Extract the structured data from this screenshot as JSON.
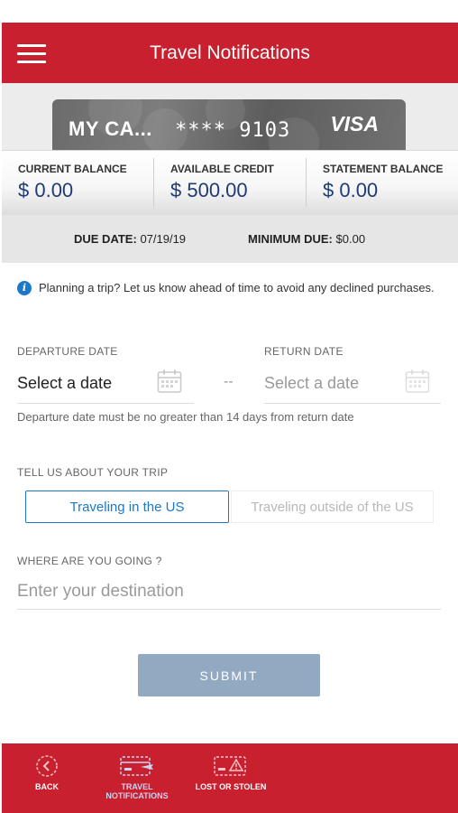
{
  "header": {
    "title": "Travel Notifications"
  },
  "card": {
    "name": "MY CA...",
    "number": "**** 9103",
    "brand": "VISA"
  },
  "balances": [
    {
      "label": "CURRENT BALANCE",
      "value": "$ 0.00"
    },
    {
      "label": "AVAILABLE CREDIT",
      "value": "$ 500.00"
    },
    {
      "label": "STATEMENT BALANCE",
      "value": "$ 0.00"
    }
  ],
  "due": {
    "due_date_label": "DUE DATE:",
    "due_date_value": "07/19/19",
    "minimum_due_label": "MINIMUM DUE:",
    "minimum_due_value": "$0.00"
  },
  "info": {
    "text": "Planning a trip? Let us know ahead of time to avoid any declined purchases."
  },
  "dates": {
    "departure_label": "DEPARTURE DATE",
    "departure_placeholder": "Select a date",
    "separator": "--",
    "return_label": "RETURN DATE",
    "return_placeholder": "Select a date",
    "hint": "Departure date must be no greater than 14 days from return date"
  },
  "trip": {
    "label": "TELL US ABOUT YOUR TRIP",
    "options": [
      "Traveling in the US",
      "Traveling outside of the US"
    ],
    "selected": "Traveling in the US"
  },
  "destination": {
    "label": "WHERE ARE YOU GOING ?",
    "placeholder": "Enter your destination"
  },
  "submit": {
    "label": "SUBMIT"
  },
  "bottom_nav": [
    {
      "label": "BACK",
      "icon": "back-circle-icon"
    },
    {
      "label": "TRAVEL NOTIFICATIONS",
      "icon": "card-plane-icon",
      "active": true
    },
    {
      "label": "LOST OR STOLEN",
      "icon": "card-alert-icon"
    }
  ],
  "colors": {
    "brand_red": "#c8202e",
    "accent_blue": "#1e78c8",
    "balance_blue": "#1f3b73",
    "submit_disabled": "#92a9c2"
  }
}
